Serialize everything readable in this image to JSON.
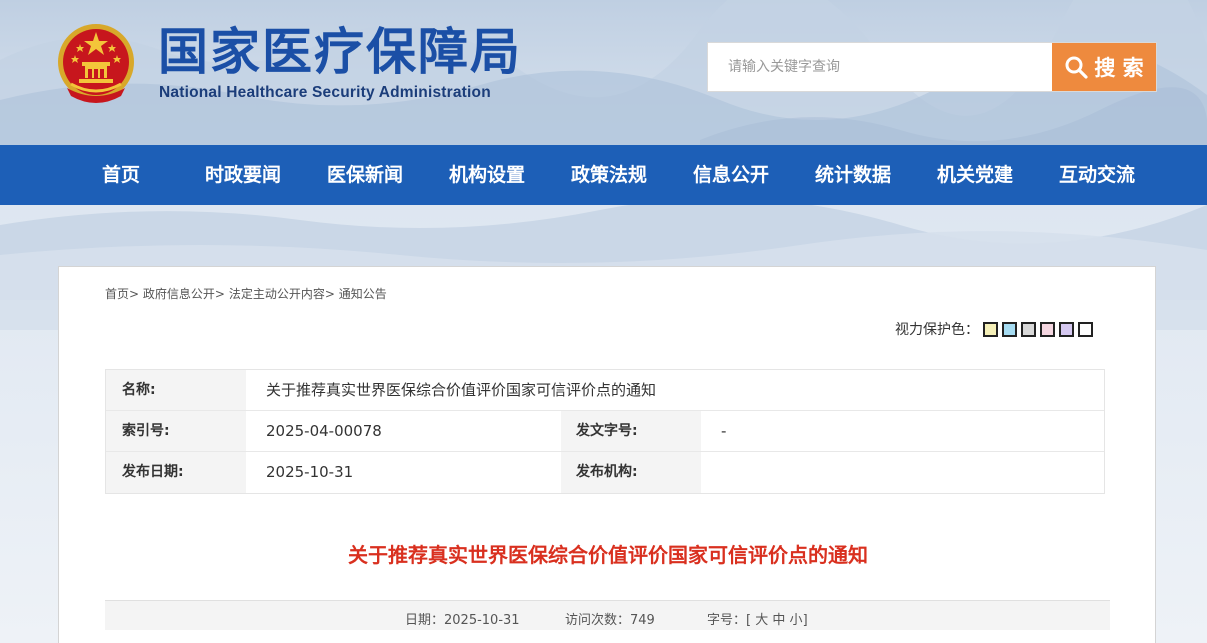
{
  "header": {
    "title": "国家医疗保障局",
    "subtitle": "National Healthcare Security Administration",
    "emblem_icon": "national-emblem-icon"
  },
  "search": {
    "placeholder": "请输入关键字查询",
    "button_label": "搜 索",
    "icon": "search-icon"
  },
  "nav": {
    "items": [
      "首页",
      "时政要闻",
      "医保新闻",
      "机构设置",
      "政策法规",
      "信息公开",
      "统计数据",
      "机关党建",
      "互动交流"
    ]
  },
  "breadcrumb": {
    "items": [
      "首页",
      "政府信息公开",
      "法定主动公开内容",
      "通知公告"
    ],
    "separator": ">"
  },
  "eye_protect": {
    "label": "视力保护色：",
    "swatches": [
      "#f5f0b8",
      "#a6dcf2",
      "#d8d8d8",
      "#f4d6e0",
      "#d5c8f0",
      "#ffffff"
    ]
  },
  "meta": {
    "name_label": "名称:",
    "name_value": "关于推荐真实世界医保综合价值评价国家可信评价点的通知",
    "index_label": "索引号:",
    "index_value": "2025-04-00078",
    "doc_no_label": "发文字号:",
    "doc_no_value": "-",
    "date_label": "发布日期:",
    "date_value": "2025-10-31",
    "org_label": "发布机构:",
    "org_value": ""
  },
  "document": {
    "title": "关于推荐真实世界医保综合价值评价国家可信评价点的通知"
  },
  "info_bar": {
    "date_label": "日期：",
    "date_value": "2025-10-31",
    "visits_label": "访问次数：",
    "visits_value": "749",
    "font_label": "字号：",
    "bracket_open": "[",
    "font_large": "大",
    "font_medium": "中",
    "font_small": "小",
    "bracket_close": "]"
  },
  "colors": {
    "nav_bg": "#1d5fb7",
    "title_blue": "#1b4fa6",
    "search_btn": "#ee8a3e",
    "doc_title_red": "#d9301f"
  }
}
